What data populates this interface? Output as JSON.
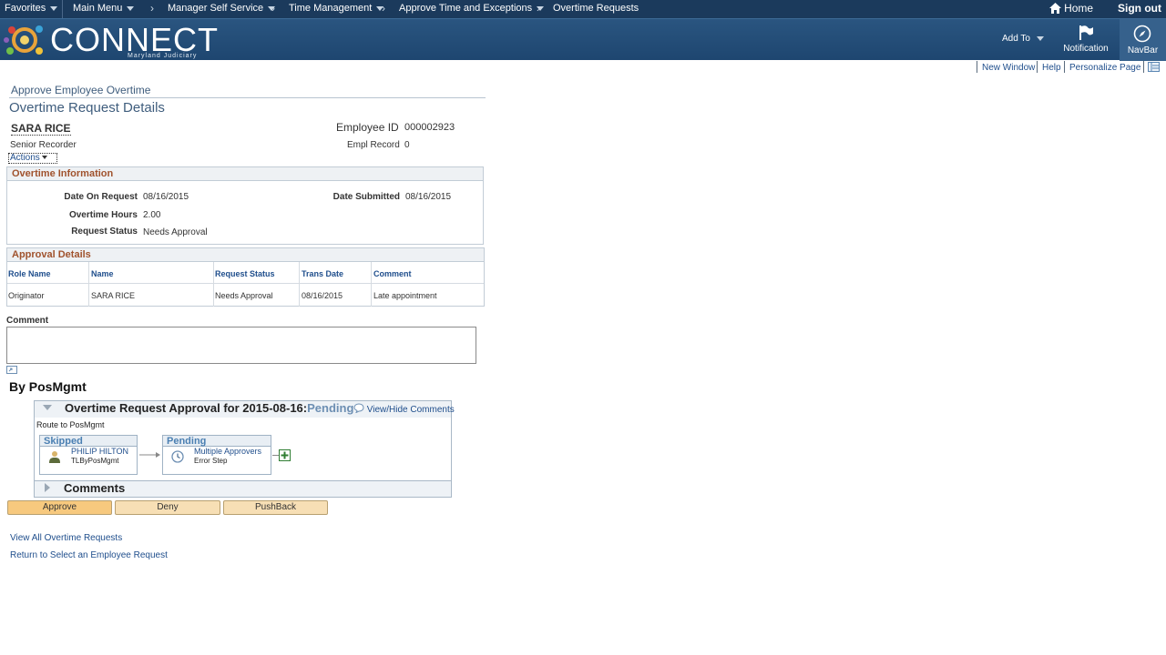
{
  "topnav": {
    "favorites": "Favorites",
    "main_menu": "Main Menu",
    "manager_self_service": "Manager Self Service",
    "time_management": "Time Management",
    "approve_time": "Approve Time and Exceptions",
    "overtime_requests": "Overtime Requests",
    "home": "Home",
    "signout": "Sign out"
  },
  "banner": {
    "logo_text": "CONNECT",
    "logo_sub": "Maryland Judiciary",
    "add_to": "Add To",
    "notification": "Notification",
    "navbar": "NavBar"
  },
  "toplinks": {
    "new_window": "New Window",
    "help": "Help",
    "personalize": "Personalize Page"
  },
  "page": {
    "subtitle": "Approve Employee Overtime",
    "title": "Overtime Request Details",
    "employee_name": "SARA RICE",
    "job_title": "Senior Recorder",
    "actions": "Actions",
    "employee_id_label": "Employee ID",
    "employee_id": "000002923",
    "empl_record_label": "Empl Record",
    "empl_record": "0"
  },
  "overtime": {
    "header": "Overtime Information",
    "date_on_request_label": "Date On Request",
    "date_on_request": "08/16/2015",
    "date_submitted_label": "Date Submitted",
    "date_submitted": "08/16/2015",
    "overtime_hours_label": "Overtime Hours",
    "overtime_hours": "2.00",
    "request_status_label": "Request Status",
    "request_status": "Needs Approval"
  },
  "approval": {
    "header": "Approval Details",
    "columns": [
      "Role Name",
      "Name",
      "Request Status",
      "Trans Date",
      "Comment"
    ],
    "rows": [
      [
        "Originator",
        "SARA RICE",
        "Needs Approval",
        "08/16/2015",
        "Late appointment"
      ]
    ]
  },
  "comment": {
    "label": "Comment",
    "value": ""
  },
  "workflow": {
    "by": "By PosMgmt",
    "title": "Overtime Request Approval for 2015-08-16:",
    "status": "Pending",
    "view_hide": "View/Hide Comments",
    "route": "Route to PosMgmt",
    "step1_status": "Skipped",
    "step1_name": "PHILIP HILTON",
    "step1_sub": "TLByPosMgmt",
    "step2_status": "Pending",
    "step2_name": "Multiple Approvers",
    "step2_sub": "Error Step",
    "comments": "Comments"
  },
  "buttons": {
    "approve": "Approve",
    "deny": "Deny",
    "pushback": "PushBack"
  },
  "links": {
    "view_all": "View All Overtime Requests",
    "return": "Return to Select an Employee Request"
  },
  "colors": {
    "topbar": "#1b3a5c",
    "button_primary": "#f7c97e",
    "button_secondary": "#f7dfb5",
    "section_header": "#a0522d"
  }
}
